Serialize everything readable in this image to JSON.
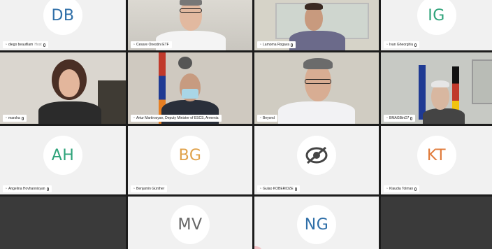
{
  "tiles": [
    {
      "id": "t1",
      "initials": "DB",
      "initials_color": "#2f6fa8",
      "name": "diego beaufilam",
      "tag": "Host"
    },
    {
      "id": "t2",
      "name": "Cesare Onestini ETF"
    },
    {
      "id": "t3",
      "name": "Lamoma Rogava"
    },
    {
      "id": "t4",
      "initials": "IG",
      "initials_color": "#2ea37a",
      "name": "Ivan Gheorghiu"
    },
    {
      "id": "t5",
      "name": "marsha"
    },
    {
      "id": "t6",
      "name": "Artur Martirosyan, Deputy Minister of ESCS, Armenia"
    },
    {
      "id": "t7",
      "name": "Beyond"
    },
    {
      "id": "t8",
      "name": "BMAGBinD7"
    },
    {
      "id": "t9",
      "initials": "AH",
      "initials_color": "#2ea37a",
      "name": "Angelina Hovhannisyan"
    },
    {
      "id": "t10",
      "initials": "BG",
      "initials_color": "#e0a24b",
      "name": "Benjamin Günther"
    },
    {
      "id": "t11",
      "name": "Gulao KOBERIDZE",
      "icon": "eye-logo-icon"
    },
    {
      "id": "t12",
      "initials": "KT",
      "initials_color": "#e07a3a",
      "name": "Klaudia Tolman"
    },
    {
      "id": "t13",
      "initials": "MV",
      "initials_color": "#666666"
    },
    {
      "id": "t14",
      "initials": "NG",
      "initials_color": "#2f6fa8"
    }
  ]
}
